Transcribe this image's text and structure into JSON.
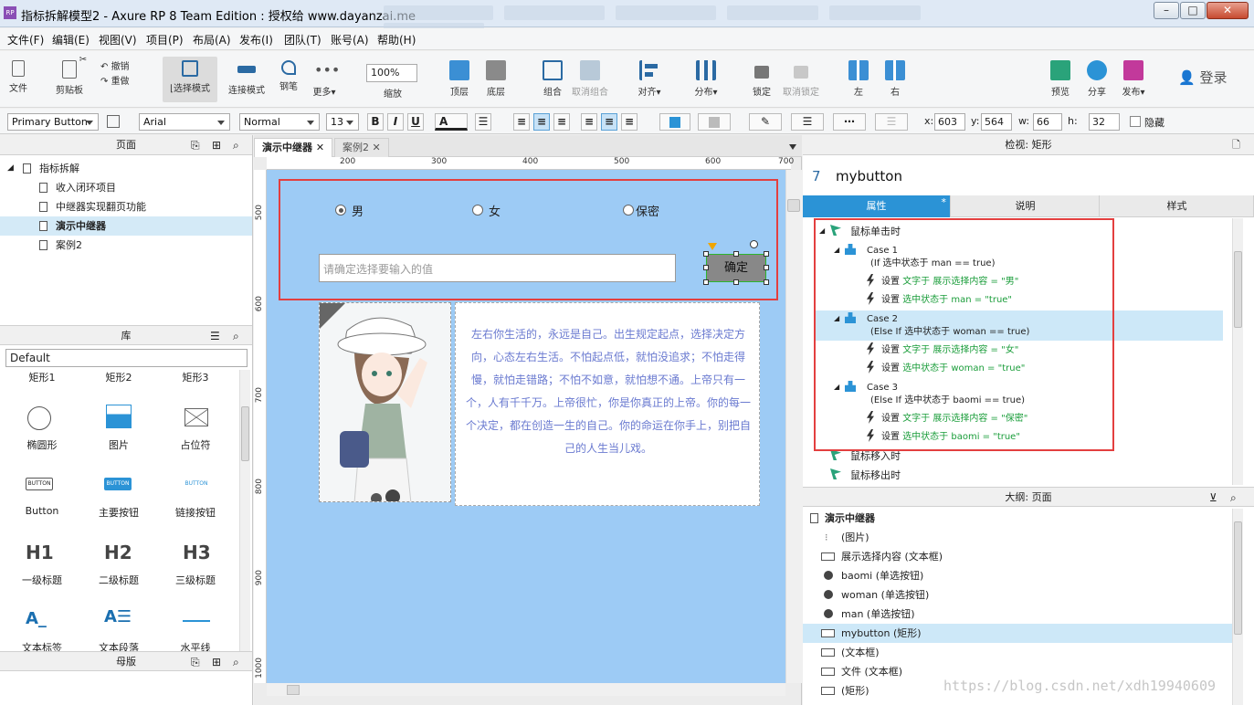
{
  "window": {
    "title": "指标拆解模型2 - Axure RP 8 Team Edition : 授权给 www.dayanzai.me",
    "logo": "RP",
    "min": "–",
    "max": "□",
    "close": "✕"
  },
  "menu": [
    "文件(F)",
    "编辑(E)",
    "视图(V)",
    "项目(P)",
    "布局(A)",
    "发布(I)",
    "团队(T)",
    "账号(A)",
    "帮助(H)"
  ],
  "toolbar": {
    "file": "文件",
    "clipboard": "剪贴板",
    "cut": "✂",
    "undo": "撤销",
    "redo": "重做",
    "select_mode": "⌊选择模式",
    "connect_mode": "连接模式",
    "pen": "钢笔",
    "more": "更多▾",
    "zoom_value": "100%",
    "zoom_label": "缩放",
    "top": "顶层",
    "bottom": "底层",
    "group": "组合",
    "ungroup": "取消组合",
    "align": "对齐▾",
    "distribute": "分布▾",
    "lock": "锁定",
    "unlock": "取消锁定",
    "left": "左",
    "right": "右",
    "preview": "预览",
    "share": "分享",
    "publish": "发布▾",
    "login": "登录"
  },
  "format": {
    "style": "Primary Button",
    "font": "Arial",
    "weight": "Normal",
    "size": "13",
    "bold": "B",
    "italic": "I",
    "underline": "U",
    "text_color": "A",
    "x_label": "x:",
    "x": "603",
    "y_label": "y:",
    "y": "564",
    "w_label": "w:",
    "w": "66",
    "h_label": "h:",
    "h": "32",
    "hidden_label": "隐藏"
  },
  "pages": {
    "title": "页面",
    "items": [
      {
        "label": "指标拆解",
        "level": 0
      },
      {
        "label": "收入闭环项目",
        "level": 1
      },
      {
        "label": "中继器实现翻页功能",
        "level": 1
      },
      {
        "label": "演示中继器",
        "level": 1,
        "selected": true
      },
      {
        "label": "案例2",
        "level": 1
      }
    ]
  },
  "library": {
    "title": "库",
    "selected": "Default",
    "items": [
      "矩形1",
      "矩形2",
      "矩形3",
      "椭圆形",
      "图片",
      "占位符",
      "Button",
      "主要按钮",
      "链接按钮",
      "一级标题",
      "二级标题",
      "三级标题",
      "文本标签",
      "文本段落",
      "水平线"
    ],
    "btn_sample": "BUTTON",
    "h1": "H1",
    "h2": "H2",
    "h3": "H3"
  },
  "masters": {
    "title": "母版"
  },
  "tabs": [
    {
      "label": "演示中继器",
      "active": true
    },
    {
      "label": "案例2",
      "active": false
    }
  ],
  "ruler": {
    "top": [
      "200",
      "300",
      "400",
      "500",
      "600",
      "700"
    ],
    "left": [
      "500",
      "600",
      "700",
      "800",
      "900",
      "1000"
    ]
  },
  "canvas": {
    "radios": [
      {
        "label": "男",
        "checked": true
      },
      {
        "label": "女",
        "checked": false
      },
      {
        "label": "保密",
        "checked": false
      }
    ],
    "input_placeholder": "请确定选择要输入的值",
    "button_label": "确定",
    "poem": "左右你生活的，永远是自己。出生规定起点，选择决定方向，心态左右生活。不怕起点低，就怕没追求；不怕走得慢，就怕走错路；不怕不如意，就怕想不通。上帝只有一个，人有千千万。上帝很忙，你是你真正的上帝。你的每一个决定，都在创造一生的自己。你的命运在你手上，别把自己的人生当儿戏。"
  },
  "inspector": {
    "title": "检视: 矩形",
    "id": "7",
    "name": "mybutton",
    "tabs": [
      "属性",
      "说明",
      "样式"
    ],
    "tab_mark": "*",
    "event": "鼠标单击时",
    "cases": [
      {
        "name": "Case 1",
        "cond": "(If 选中状态于 man == true)",
        "actions": [
          {
            "verb": "设置 ",
            "text": "文字于 展示选择内容 = \"男\""
          },
          {
            "verb": "设置 ",
            "text": "选中状态于 man = \"true\""
          }
        ]
      },
      {
        "name": "Case 2",
        "cond": "(Else If 选中状态于 woman == true)",
        "actions": [
          {
            "verb": "设置 ",
            "text": "文字于 展示选择内容 = \"女\""
          },
          {
            "verb": "设置 ",
            "text": "选中状态于 woman = \"true\""
          }
        ]
      },
      {
        "name": "Case 3",
        "cond": "(Else If 选中状态于 baomi == true)",
        "actions": [
          {
            "verb": "设置 ",
            "text": "文字于 展示选择内容 = \"保密\""
          },
          {
            "verb": "设置 ",
            "text": "选中状态于 baomi = \"true\""
          }
        ]
      }
    ],
    "more_events": [
      "鼠标移入时",
      "鼠标移出时"
    ]
  },
  "outline": {
    "title": "大纲: 页面",
    "root": "演示中继器",
    "items": [
      {
        "label": "(图片)",
        "icon": "image"
      },
      {
        "label": "展示选择内容 (文本框)",
        "icon": "rect"
      },
      {
        "label": "baomi (单选按钮)",
        "icon": "dot"
      },
      {
        "label": "woman (单选按钮)",
        "icon": "dot"
      },
      {
        "label": "man (单选按钮)",
        "icon": "dot"
      },
      {
        "label": "mybutton (矩形)",
        "icon": "rect",
        "selected": true
      },
      {
        "label": "(文本框)",
        "icon": "rect"
      },
      {
        "label": "文件 (文本框)",
        "icon": "rect"
      },
      {
        "label": "(矩形)",
        "icon": "rect"
      }
    ]
  },
  "watermark": "https://blog.csdn.net/xdh19940609",
  "colors": {
    "accent": "#2b93d6",
    "highlight": "#e33f3f",
    "canvas_bg": "#9dcbf5",
    "action_green": "#1a9d3a"
  }
}
